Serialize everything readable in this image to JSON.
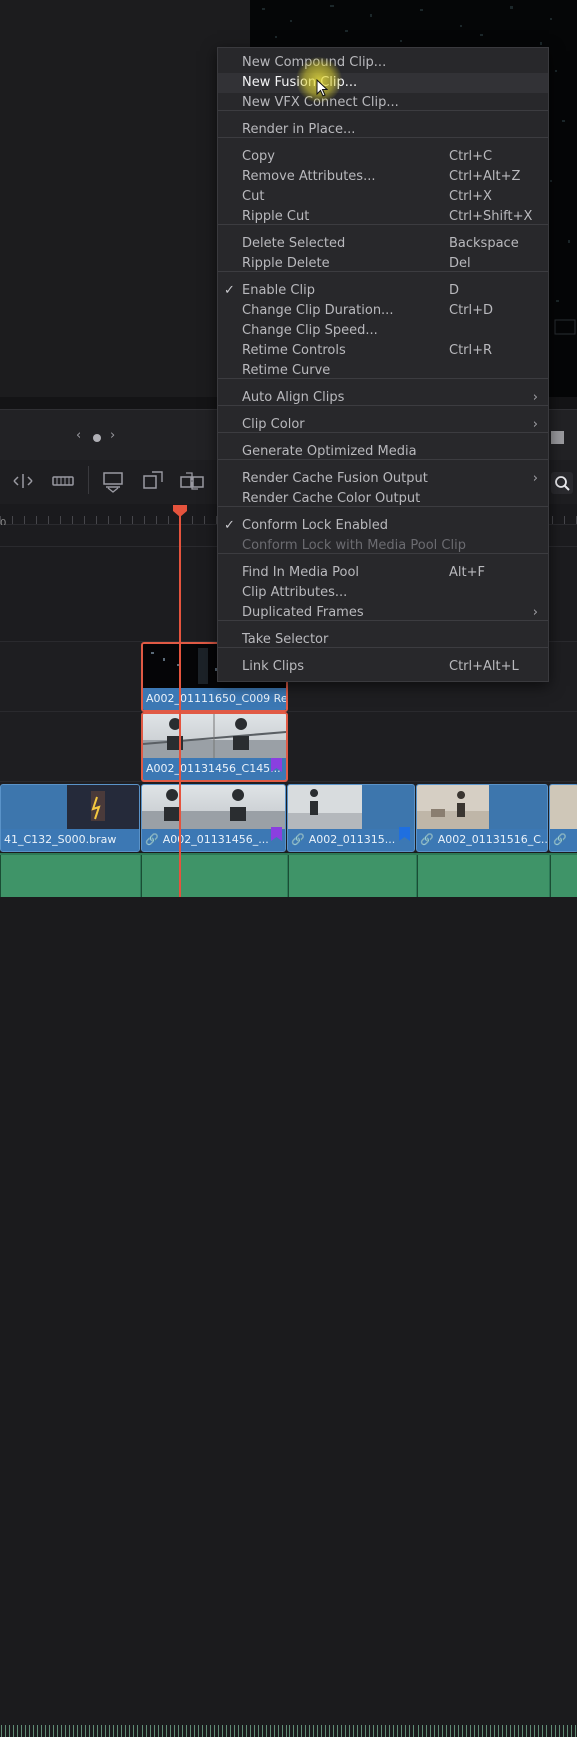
{
  "nav": {
    "prev": "‹",
    "next": "›"
  },
  "timeline": {
    "ruler_zero": "0",
    "clips": {
      "v3_selected": "A002_01111650_C009 Re...",
      "v2_selected": "A002_01131456_C145...",
      "v1_clip1": "41_C132_S000.braw",
      "v1_clip2": "A002_01131456_...",
      "v1_clip3": "A002_011315...",
      "v1_clip4": "A002_01131516_C..."
    },
    "marker_colors": {
      "purple": "#8a3fe0",
      "blue": "#1f6fe0"
    },
    "playhead_color": "#e5533d"
  },
  "context_menu": {
    "items": [
      {
        "label": "New Compound Clip...",
        "shortcut": "",
        "state": "normal"
      },
      {
        "label": "New Fusion Clip...",
        "shortcut": "",
        "state": "hover"
      },
      {
        "label": "New VFX Connect Clip...",
        "shortcut": "",
        "state": "normal"
      },
      {
        "label": "Render in Place...",
        "shortcut": "",
        "state": "normal"
      },
      {
        "label": "Copy",
        "shortcut": "Ctrl+C",
        "state": "normal"
      },
      {
        "label": "Remove Attributes...",
        "shortcut": "Ctrl+Alt+Z",
        "state": "normal"
      },
      {
        "label": "Cut",
        "shortcut": "Ctrl+X",
        "state": "normal"
      },
      {
        "label": "Ripple Cut",
        "shortcut": "Ctrl+Shift+X",
        "state": "normal"
      },
      {
        "label": "Delete Selected",
        "shortcut": "Backspace",
        "state": "normal"
      },
      {
        "label": "Ripple Delete",
        "shortcut": "Del",
        "state": "normal"
      },
      {
        "label": "Enable Clip",
        "shortcut": "D",
        "state": "checked"
      },
      {
        "label": "Change Clip Duration...",
        "shortcut": "Ctrl+D",
        "state": "normal"
      },
      {
        "label": "Change Clip Speed...",
        "shortcut": "",
        "state": "normal"
      },
      {
        "label": "Retime Controls",
        "shortcut": "Ctrl+R",
        "state": "normal"
      },
      {
        "label": "Retime Curve",
        "shortcut": "",
        "state": "normal"
      },
      {
        "label": "Auto Align Clips",
        "shortcut": "",
        "state": "submenu"
      },
      {
        "label": "Clip Color",
        "shortcut": "",
        "state": "submenu"
      },
      {
        "label": "Generate Optimized Media",
        "shortcut": "",
        "state": "normal"
      },
      {
        "label": "Render Cache Fusion Output",
        "shortcut": "",
        "state": "submenu"
      },
      {
        "label": "Render Cache Color Output",
        "shortcut": "",
        "state": "normal"
      },
      {
        "label": "Conform Lock Enabled",
        "shortcut": "",
        "state": "checked"
      },
      {
        "label": "Conform Lock with Media Pool Clip",
        "shortcut": "",
        "state": "disabled"
      },
      {
        "label": "Find In Media Pool",
        "shortcut": "Alt+F",
        "state": "normal"
      },
      {
        "label": "Clip Attributes...",
        "shortcut": "",
        "state": "normal"
      },
      {
        "label": "Duplicated Frames",
        "shortcut": "",
        "state": "submenu"
      },
      {
        "label": "Take Selector",
        "shortcut": "",
        "state": "normal"
      },
      {
        "label": "Link Clips",
        "shortcut": "Ctrl+Alt+L",
        "state": "normal"
      }
    ],
    "submenu_glyph": "›",
    "check_glyph": "✓"
  }
}
